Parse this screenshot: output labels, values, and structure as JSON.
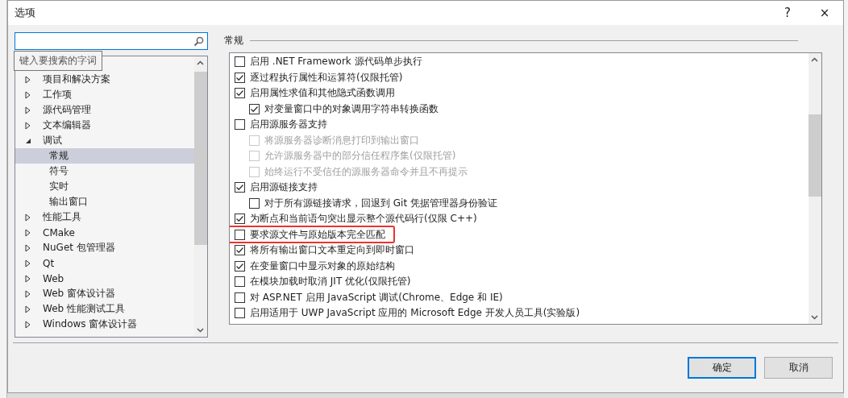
{
  "window": {
    "title": "选项",
    "help": "?",
    "close": "×"
  },
  "search": {
    "tooltip": "键入要搜索的字词"
  },
  "tree": [
    {
      "label": "项目和解决方案",
      "expanded": false,
      "selected": false
    },
    {
      "label": "工作项",
      "expanded": false,
      "selected": false
    },
    {
      "label": "源代码管理",
      "expanded": false,
      "selected": false
    },
    {
      "label": "文本编辑器",
      "expanded": false,
      "selected": false
    },
    {
      "label": "调试",
      "expanded": true,
      "selected": false,
      "children": [
        {
          "label": "常规",
          "selected": true
        },
        {
          "label": "符号",
          "selected": false
        },
        {
          "label": "实时",
          "selected": false
        },
        {
          "label": "输出窗口",
          "selected": false
        }
      ]
    },
    {
      "label": "性能工具",
      "expanded": false,
      "selected": false
    },
    {
      "label": "CMake",
      "expanded": false,
      "selected": false
    },
    {
      "label": "NuGet 包管理器",
      "expanded": false,
      "selected": false
    },
    {
      "label": "Qt",
      "expanded": false,
      "selected": false
    },
    {
      "label": "Web",
      "expanded": false,
      "selected": false
    },
    {
      "label": "Web 窗体设计器",
      "expanded": false,
      "selected": false
    },
    {
      "label": "Web 性能测试工具",
      "expanded": false,
      "selected": false
    },
    {
      "label": "Windows 窗体设计器",
      "expanded": false,
      "selected": false
    }
  ],
  "section_title": "常规",
  "options": [
    {
      "label": "启用 .NET Framework 源代码单步执行",
      "checked": false,
      "disabled": false,
      "highlighted": false
    },
    {
      "label": "逐过程执行属性和运算符(仅限托管)",
      "checked": true,
      "disabled": false,
      "highlighted": false
    },
    {
      "label": "启用属性求值和其他隐式函数调用",
      "checked": true,
      "disabled": false,
      "highlighted": false,
      "children": [
        {
          "label": "对变量窗口中的对象调用字符串转换函数",
          "checked": true,
          "disabled": false,
          "highlighted": false
        }
      ]
    },
    {
      "label": "启用源服务器支持",
      "checked": false,
      "disabled": false,
      "highlighted": false,
      "children": [
        {
          "label": "将源服务器诊断消息打印到输出窗口",
          "checked": false,
          "disabled": true,
          "highlighted": false
        },
        {
          "label": "允许源服务器中的部分信任程序集(仅限托管)",
          "checked": false,
          "disabled": true,
          "highlighted": false
        },
        {
          "label": "始终运行不受信任的源服务器命令并且不再提示",
          "checked": false,
          "disabled": true,
          "highlighted": false
        }
      ]
    },
    {
      "label": "启用源链接支持",
      "checked": true,
      "disabled": false,
      "highlighted": false,
      "children": [
        {
          "label": "对于所有源链接请求，回退到 Git 凭据管理器身份验证",
          "checked": false,
          "disabled": false,
          "highlighted": false
        }
      ]
    },
    {
      "label": "为断点和当前语句突出显示整个源代码行(仅限 C++)",
      "checked": true,
      "disabled": false,
      "highlighted": false
    },
    {
      "label": "要求源文件与原始版本完全匹配",
      "checked": false,
      "disabled": false,
      "highlighted": true
    },
    {
      "label": "将所有输出窗口文本重定向到即时窗口",
      "checked": true,
      "disabled": false,
      "highlighted": false
    },
    {
      "label": "在变量窗口中显示对象的原始结构",
      "checked": true,
      "disabled": false,
      "highlighted": false
    },
    {
      "label": "在模块加载时取消 JIT 优化(仅限托管)",
      "checked": false,
      "disabled": false,
      "highlighted": false
    },
    {
      "label": "对 ASP.NET 启用 JavaScript 调试(Chrome、Edge 和 IE)",
      "checked": false,
      "disabled": false,
      "highlighted": false
    },
    {
      "label": "启用适用于 UWP JavaScript 应用的 Microsoft Edge 开发人员工具(实验版)",
      "checked": false,
      "disabled": false,
      "highlighted": false
    }
  ],
  "buttons": [
    {
      "label": "确定",
      "default": true
    },
    {
      "label": "取消",
      "default": false
    }
  ]
}
